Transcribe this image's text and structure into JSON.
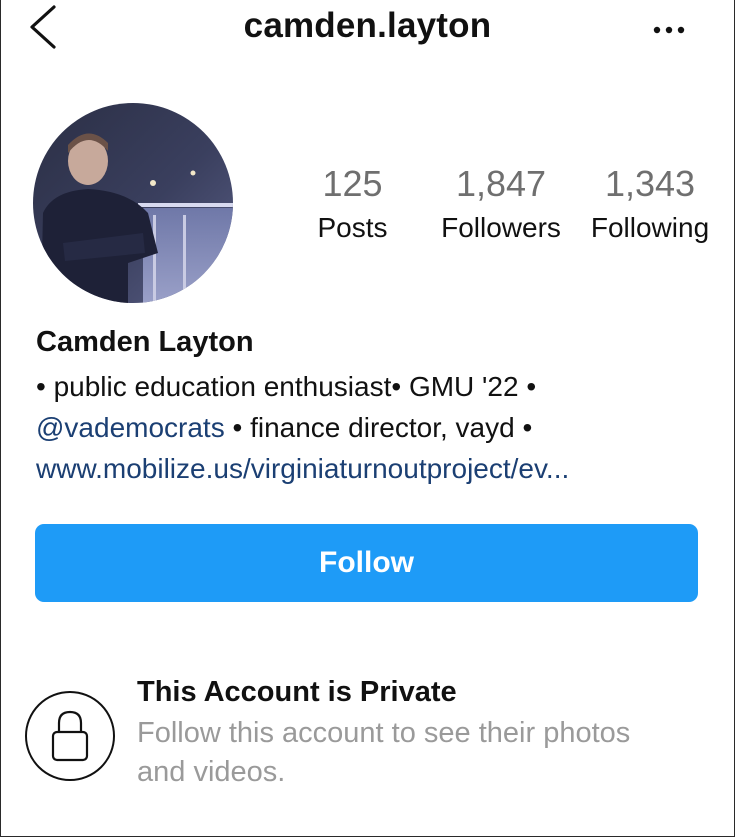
{
  "header": {
    "username": "camden.layton",
    "back_icon": "chevron-left-icon",
    "more_icon": "ellipsis-icon"
  },
  "profile": {
    "avatar_icon": "profile-photo",
    "stats": [
      {
        "value": "125",
        "label": "Posts"
      },
      {
        "value": "1,847",
        "label": "Followers"
      },
      {
        "value": "1,343",
        "label": "Following"
      }
    ],
    "full_name": "Camden Layton",
    "bio": {
      "line1": "• public education enthusiast• GMU '22 •",
      "mention": "@vademocrats",
      "line2_rest": " • finance director, vayd •",
      "link": "www.mobilize.us/virginiaturnoutproject/ev..."
    }
  },
  "actions": {
    "follow_label": "Follow"
  },
  "private": {
    "icon": "lock-icon",
    "title": "This Account is Private",
    "subtitle": "Follow this account to see their photos and videos."
  },
  "colors": {
    "accent": "#1e9bf7",
    "link": "#1b3f73",
    "muted": "#9a9a9a"
  }
}
